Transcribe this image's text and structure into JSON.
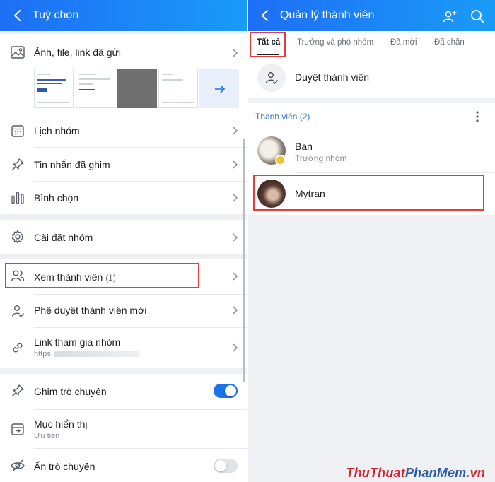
{
  "left": {
    "title": "Tuỳ chọn",
    "media": {
      "label": "Ảnh, file, link đã gửi"
    },
    "menu": [
      {
        "label": "Lịch nhóm"
      },
      {
        "label": "Tin nhắn đã ghim"
      },
      {
        "label": "Bình chọn"
      }
    ],
    "settings": {
      "label": "Cài đặt nhóm"
    },
    "members": {
      "view_label": "Xem thành viên",
      "view_count": "(1)",
      "approve_label": "Phê duyệt thành viên mới",
      "link_label": "Link tham gia nhóm",
      "link_value": "https"
    },
    "pin_chat": {
      "label": "Ghim trò chuyện",
      "enabled": true
    },
    "display": {
      "label": "Mục hiển thị",
      "value": "Ưu tiên"
    },
    "hide_chat": {
      "label": "Ẩn trò chuyện",
      "enabled": false
    }
  },
  "right": {
    "title": "Quản lý thành viên",
    "tabs": [
      "Tất cả",
      "Trưởng và phó nhóm",
      "Đã mời",
      "Đã chặn"
    ],
    "approve_label": "Duyệt thành viên",
    "section_title": "Thành viên (2)",
    "members": [
      {
        "name": "Bạn",
        "role": "Trưởng nhóm"
      },
      {
        "name": "Mytran",
        "role": ""
      }
    ]
  },
  "watermark": {
    "part1": "ThuThuat",
    "part2": "PhanMem",
    "part3": ".vn"
  },
  "colors": {
    "header_start": "#1e6ef5",
    "header_end": "#1a9bf7",
    "highlight": "#e53b3b",
    "toggle_on": "#1a73e8",
    "section_title": "#2f77d6"
  },
  "icons": {
    "media": "image-icon",
    "calendar": "calendar-icon",
    "pin": "pin-icon",
    "poll": "poll-icon",
    "settings": "gear-icon",
    "members": "members-icon",
    "approve": "user-check-icon",
    "link": "link-icon",
    "display": "inbox-icon",
    "hide": "eye-off-icon",
    "add_member": "add-user-icon",
    "search": "search-icon"
  }
}
